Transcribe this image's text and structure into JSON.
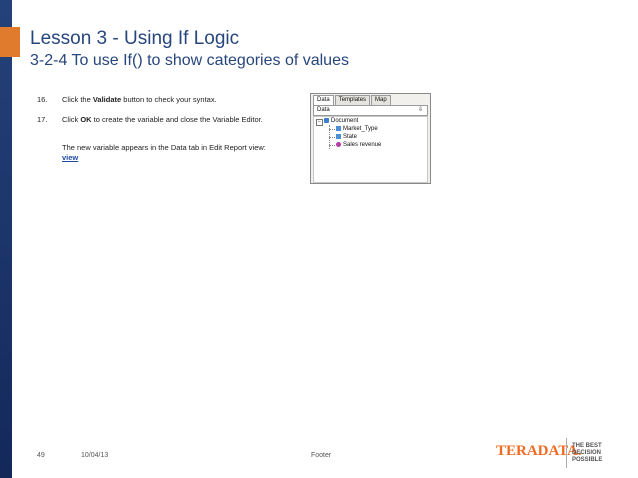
{
  "slide": {
    "title": "Lesson 3 - Using If Logic",
    "subtitle": "3-2-4 To use If() to show categories of values"
  },
  "steps": [
    {
      "number": "16.",
      "line1_pre": "Click the ",
      "line1_bold": "Validate",
      "line1_post": " button to check your syntax."
    },
    {
      "number": "17.",
      "line1_pre": "Click ",
      "line1_bold": "OK",
      "line1_post": " to create the variable and close the Variable Editor.",
      "note": "The new variable appears in the Data tab in Edit Report view: ",
      "link": "view"
    }
  ],
  "panel": {
    "tabs": [
      "Data",
      "Templates",
      "Map"
    ],
    "header": "Data",
    "root": "Document",
    "items": [
      "Market_Type",
      "State",
      "Sales revenue"
    ]
  },
  "footer": {
    "page_number": "49",
    "date": "10/04/13",
    "text": "Footer",
    "brand": "TERADATA.",
    "tagline": [
      "THE BEST",
      "DECISION",
      "POSSIBLE"
    ]
  },
  "colors": {
    "title": "#27467d",
    "accent_orange": "#e07a2c",
    "left_band": "#1c3366",
    "brand": "#f06a22"
  }
}
